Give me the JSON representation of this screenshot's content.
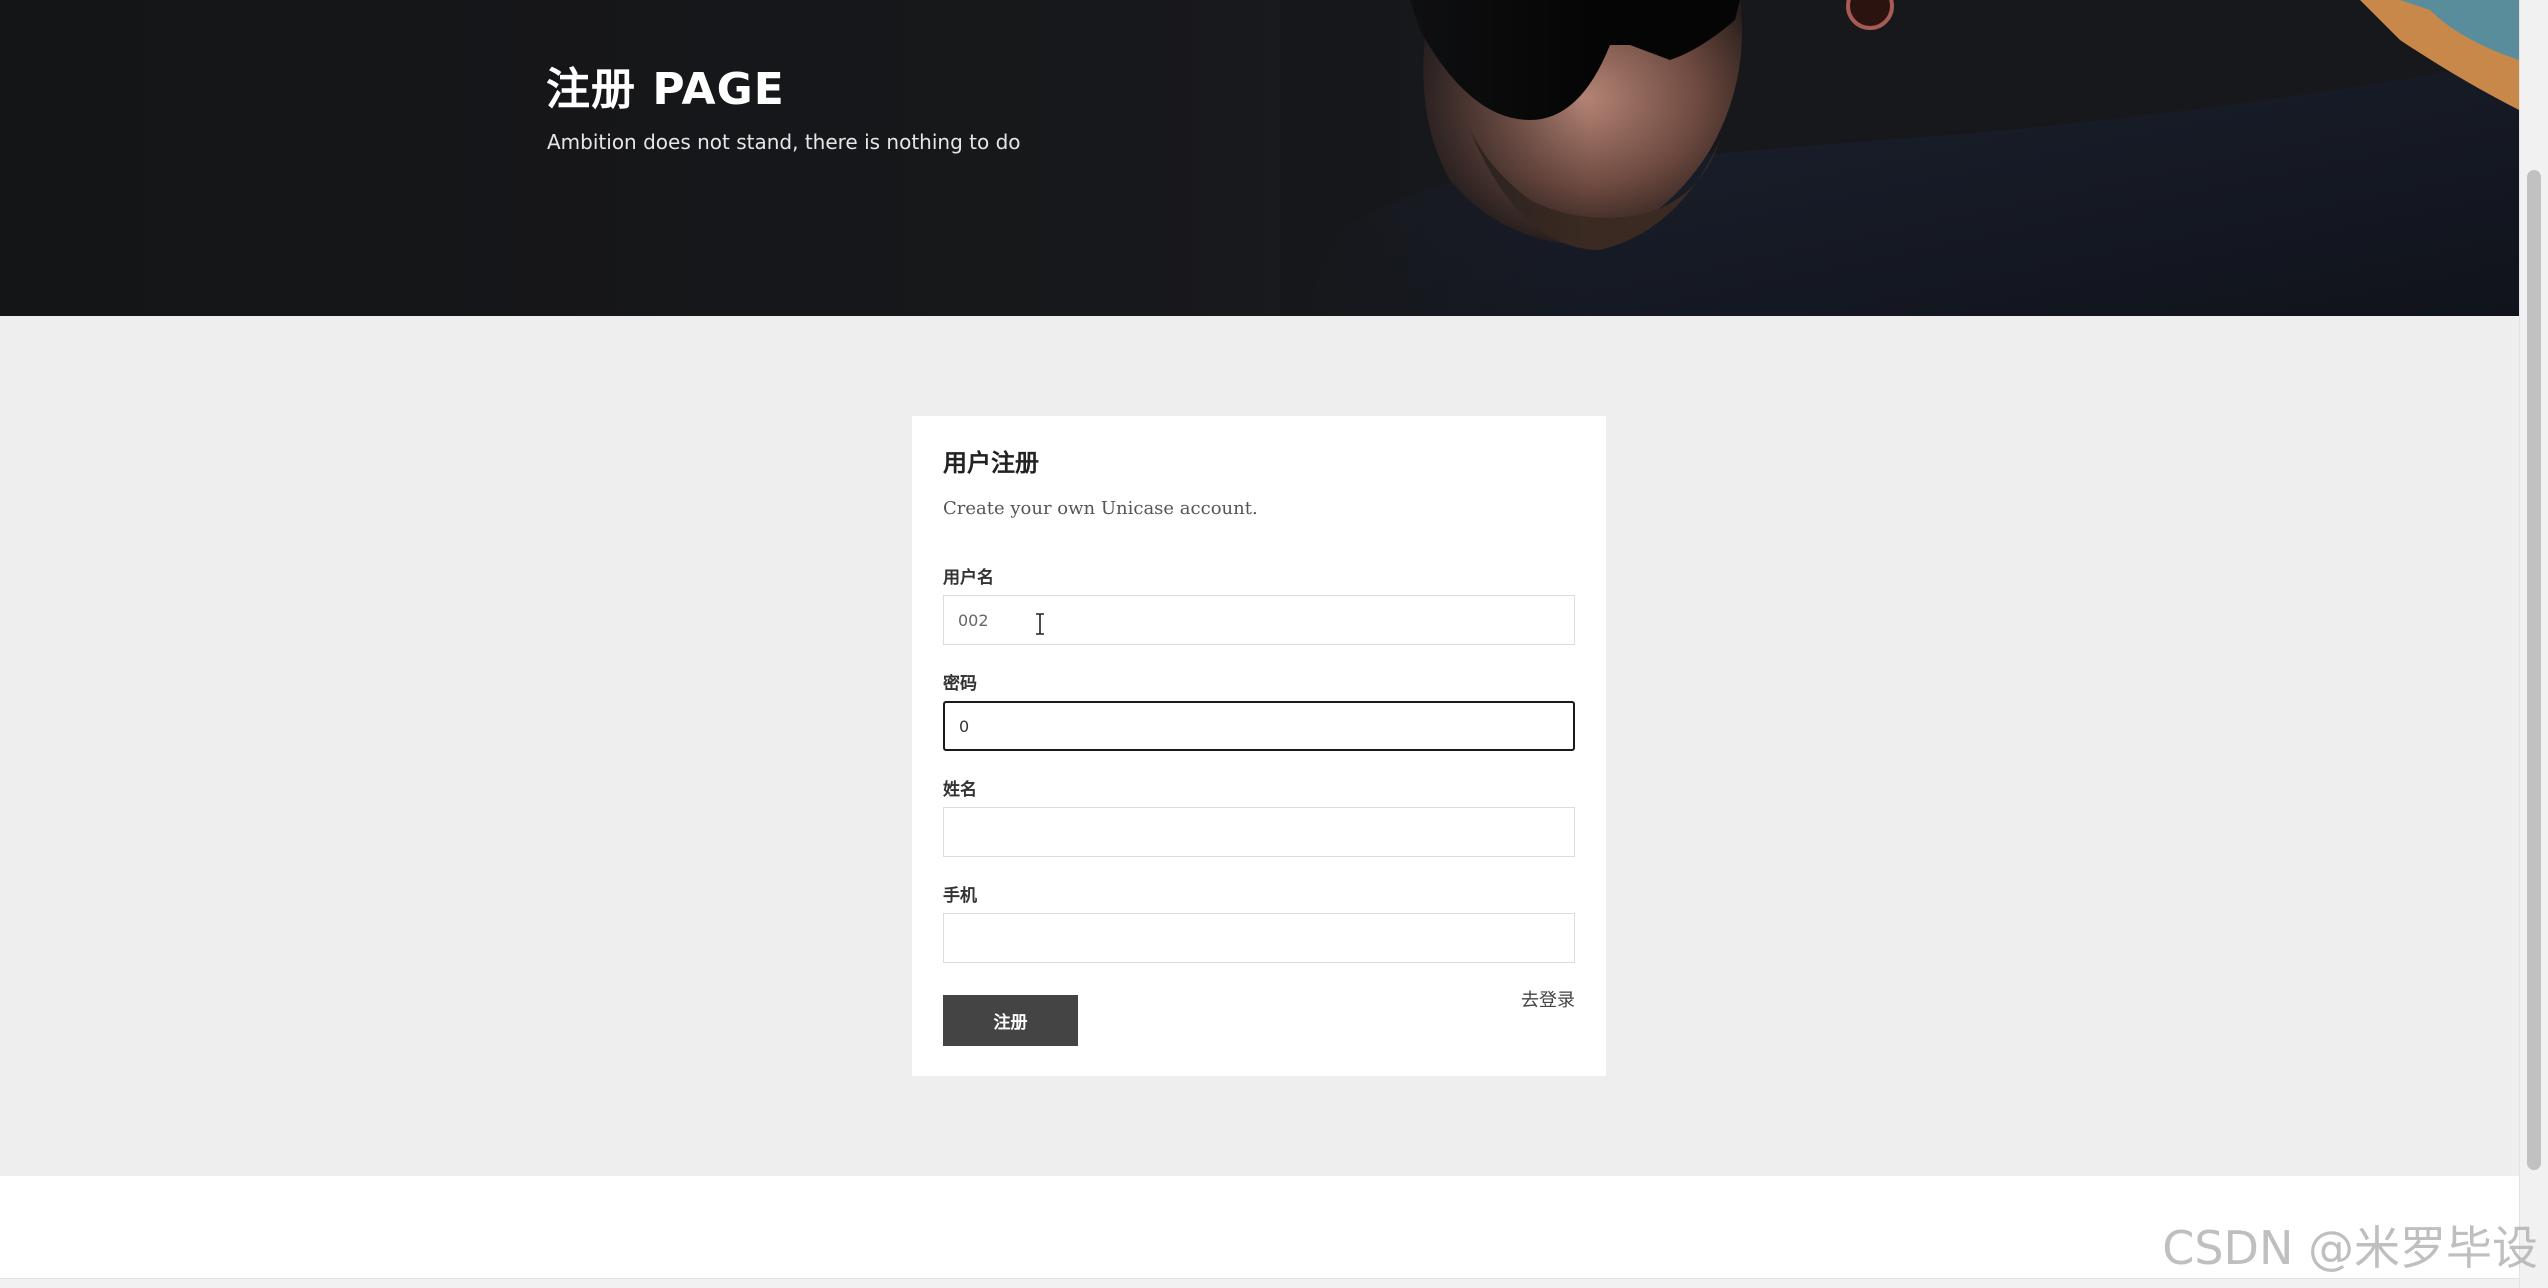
{
  "hero": {
    "title": "注册 PAGE",
    "subtitle": "Ambition does not stand, there is nothing to do"
  },
  "form": {
    "title": "用户注册",
    "subtitle": "Create your own Unicase account.",
    "fields": [
      {
        "label": "用户名",
        "value": "002"
      },
      {
        "label": "密码",
        "value": "0"
      },
      {
        "label": "姓名",
        "value": ""
      },
      {
        "label": "手机",
        "value": ""
      }
    ],
    "submit_label": "注册",
    "login_link": "去登录"
  },
  "watermark": "CSDN @米罗毕设",
  "colors": {
    "hero_bg": "#141517",
    "page_bg": "#eeeeee",
    "button_bg": "#444444",
    "focus_border": "#1a1a1a"
  }
}
